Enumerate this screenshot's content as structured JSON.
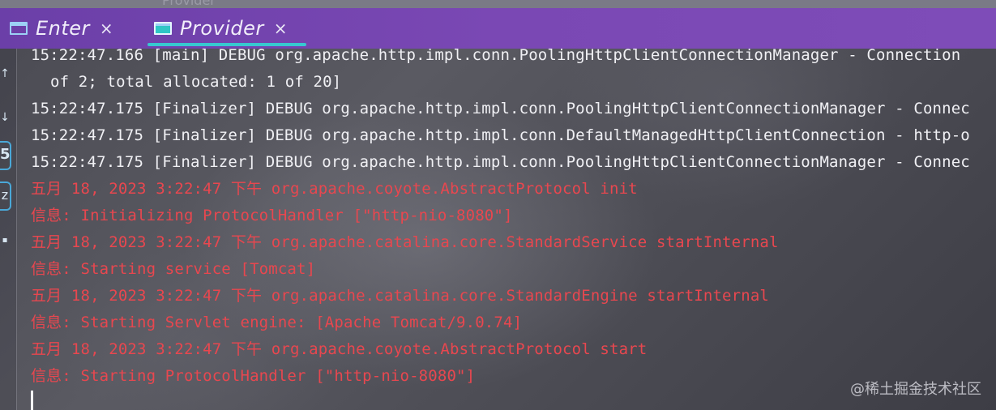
{
  "background_title": "Provider",
  "tabs": [
    {
      "label": "Enter",
      "close": "×",
      "active": false
    },
    {
      "label": "Provider",
      "close": "×",
      "active": true
    }
  ],
  "gutter": {
    "glyphs": [
      "↑",
      "↓",
      "5",
      "z",
      "▪"
    ]
  },
  "console": {
    "lines": [
      "15:22:47.166 [main] DEBUG org.apache.http.impl.conn.PoolingHttpClientConnectionManager - Connection",
      "of 2; total allocated: 1 of 20]",
      "15:22:47.175 [Finalizer] DEBUG org.apache.http.impl.conn.PoolingHttpClientConnectionManager - Connec",
      "15:22:47.175 [Finalizer] DEBUG org.apache.http.impl.conn.DefaultManagedHttpClientConnection - http-o",
      "15:22:47.175 [Finalizer] DEBUG org.apache.http.impl.conn.PoolingHttpClientConnectionManager - Connec",
      "五月 18, 2023 3:22:47 下午 org.apache.coyote.AbstractProtocol init",
      "信息: Initializing ProtocolHandler [\"http-nio-8080\"]",
      "五月 18, 2023 3:22:47 下午 org.apache.catalina.core.StandardService startInternal",
      "信息: Starting service [Tomcat]",
      "五月 18, 2023 3:22:47 下午 org.apache.catalina.core.StandardEngine startInternal",
      "信息: Starting Servlet engine: [Apache Tomcat/9.0.74]",
      "五月 18, 2023 3:22:47 下午 org.apache.coyote.AbstractProtocol start",
      "信息: Starting ProtocolHandler [\"http-nio-8080\"]"
    ]
  },
  "watermark": "@稀土掘金技术社区",
  "colors": {
    "tabbar": "#7a48b4",
    "active_underline": "#37c8d0",
    "log_default": "#f0f0f4",
    "log_error": "#e8474f"
  }
}
